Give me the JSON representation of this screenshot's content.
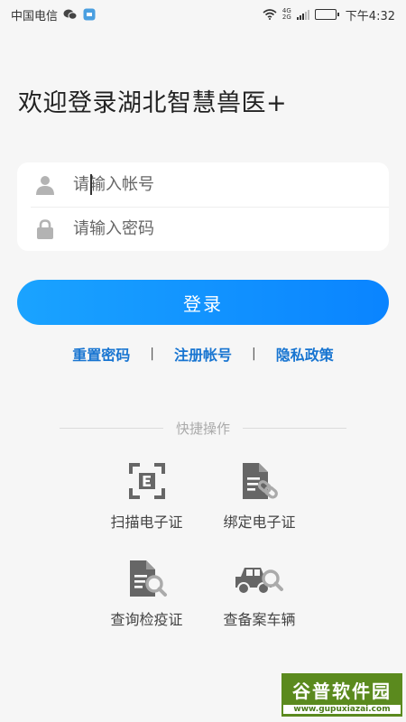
{
  "status_bar": {
    "carrier": "中国电信",
    "network_top": "4G",
    "network_bottom": "2G",
    "time": "下午4:32",
    "battery_level": 0.8
  },
  "page": {
    "welcome": "欢迎登录湖北智慧兽医+"
  },
  "login_form": {
    "account_placeholder": "请输入帐号",
    "password_placeholder": "请输入密码",
    "account_value": "",
    "password_value": "",
    "account_icon": "user-icon",
    "password_icon": "lock-icon"
  },
  "login_button": {
    "label": "登录"
  },
  "links": {
    "reset_password": "重置密码",
    "register": "注册帐号",
    "privacy": "隐私政策",
    "separator": "|"
  },
  "quick_actions": {
    "title": "快捷操作",
    "items": [
      {
        "label": "扫描电子证",
        "icon": "scan-certificate-icon"
      },
      {
        "label": "绑定电子证",
        "icon": "bind-certificate-icon"
      },
      {
        "label": "查询检疫证",
        "icon": "search-quarantine-icon"
      },
      {
        "label": "查备案车辆",
        "icon": "search-vehicle-icon"
      }
    ]
  },
  "watermark": {
    "main": "谷普软件园",
    "sub": "www.gupuxiazai.com"
  },
  "colors": {
    "accent": "#0a84ff",
    "link": "#1875d1",
    "background": "#f6f6f6",
    "icon_gray": "#666666"
  }
}
